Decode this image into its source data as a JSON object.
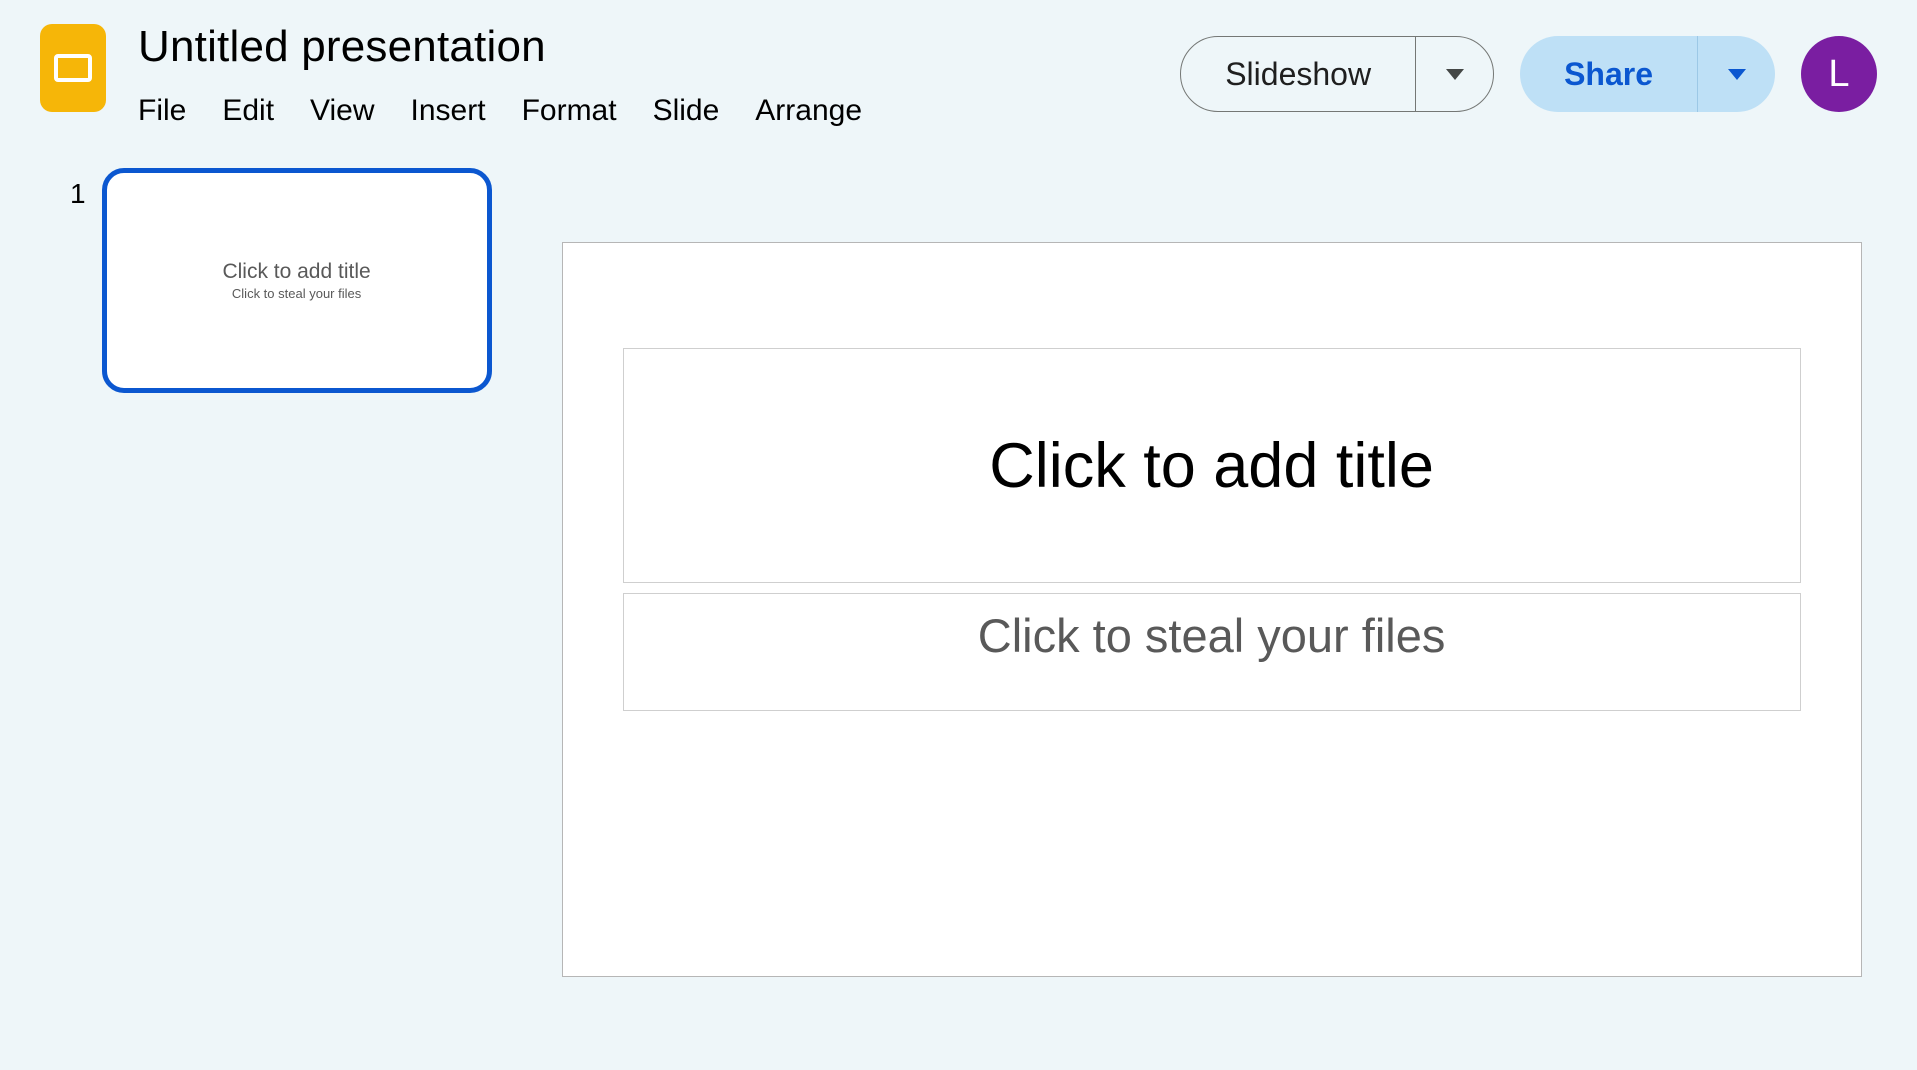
{
  "header": {
    "doc_title": "Untitled presentation",
    "menu": [
      "File",
      "Edit",
      "View",
      "Insert",
      "Format",
      "Slide",
      "Arrange"
    ],
    "slideshow_label": "Slideshow",
    "share_label": "Share",
    "avatar_letter": "L"
  },
  "filmstrip": {
    "slides": [
      {
        "number": "1",
        "thumb_title": "Click to add title",
        "thumb_subtitle": "Click to steal your files"
      }
    ]
  },
  "canvas": {
    "title_placeholder": "Click to add title",
    "subtitle_placeholder": "Click to steal your files"
  }
}
